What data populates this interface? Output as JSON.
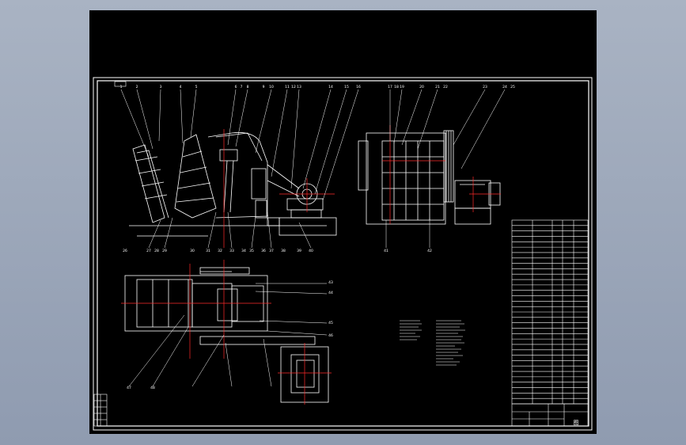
{
  "viewport": {
    "background_color": "#9aa5b8",
    "canvas_color": "#000000"
  },
  "colors": {
    "frame": "#ffffff",
    "linework": "#ffffff",
    "centerline": "#ff2a2a",
    "callout_text": "#ffffff"
  },
  "drawing": {
    "kind": "CAD assembly drawing",
    "views": [
      "side-elevation",
      "end-elevation",
      "top-plan",
      "detail-section"
    ],
    "callout_labels": [
      "1",
      "2",
      "3",
      "4",
      "5",
      "6",
      "7",
      "8",
      "9",
      "10",
      "11",
      "12",
      "13",
      "14",
      "15",
      "16",
      "17",
      "18",
      "19",
      "20",
      "21",
      "22",
      "23",
      "24",
      "25",
      "26",
      "27",
      "28",
      "29",
      "30",
      "31",
      "32",
      "33",
      "34",
      "35",
      "36",
      "37",
      "38",
      "39",
      "40",
      "41",
      "42",
      "43",
      "44",
      "45",
      "46",
      "47",
      "48"
    ],
    "parts_list_rows": 34,
    "title_block_cell": "图"
  }
}
